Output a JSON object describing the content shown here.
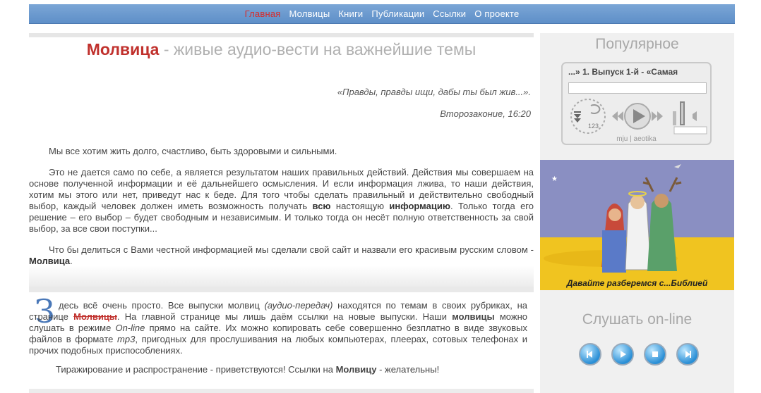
{
  "nav": {
    "items": [
      {
        "label": "Главная",
        "active": true
      },
      {
        "label": "Молвицы",
        "active": false
      },
      {
        "label": "Книги",
        "active": false
      },
      {
        "label": "Публикации",
        "active": false
      },
      {
        "label": "Ссылки",
        "active": false
      },
      {
        "label": "О проекте",
        "active": false
      }
    ]
  },
  "main": {
    "headline_brand": "Молвица",
    "headline_rest": " - живые аудио-вести на важнейшие темы",
    "quote": "«Правды, правды ищи, дабы ты был жив...».",
    "quote_source": "Второзаконие, 16:20",
    "paragraph1": "Мы все хотим жить долго, счастливо, быть здоровыми и сильными.",
    "paragraph2_a": "Это не дается само по себе, а является результатом наших правильных действий. Действия мы совершаем на основе полученной информации и её дальнейшего осмысления. И если информация лжива, то наши действия, хотим мы этого или нет, приведут нас к беде. Для того чтобы сделать правильный и действительно свободный выбор, каждый человек должен иметь возможность получать ",
    "paragraph2_b1": "всю",
    "paragraph2_mid": " настоящую ",
    "paragraph2_b2": "информацию",
    "paragraph2_c": ". Только тогда его решение – его выбор – будет свободным и независимым. И только тогда он несёт полную ответственность за свой выбор, за все свои поступки...",
    "paragraph3_a": "Что бы делиться с Вами честной информацией мы сделали свой сайт и назвали его красивым русским словом - ",
    "paragraph3_b": "Молвица",
    "paragraph3_c": ".",
    "dropcap": "З",
    "paragraph4_a": "десь всё очень просто. Все выпуски молвиц ",
    "paragraph4_i1": "(аудио-передач)",
    "paragraph4_b": " находятся по темам в своих рубриках, на странице ",
    "paragraph4_link": "Молвицы",
    "paragraph4_c": ". На главной странице мы лишь даём ссылки на новые выпуски. Наши ",
    "paragraph4_b2": "молвицы",
    "paragraph4_d": " можно слушать в режиме ",
    "paragraph4_i2": "On-line",
    "paragraph4_e": " прямо на сайте. Их можно копировать себе совершенно безплатно в виде звуковых файлов в формате ",
    "paragraph4_i3": "mp3",
    "paragraph4_f": ", пригодных для прослушивания на любых компьютерах, плеерах, сотовых телефонах и прочих подобных приспособлениях.",
    "paragraph5_a": "Тиражирование и распространение - приветствуются! Ссылки на ",
    "paragraph5_b": "Молвицу",
    "paragraph5_c": " - желательны!"
  },
  "sidebar": {
    "popular_title": "Популярное",
    "player_track": "...» 1. Выпуск 1-й - «Самая",
    "player_brand": "mju | aeotika",
    "player_counter": "123",
    "image_caption": "Давайте разберемся с...Библией",
    "listen_title": "Слушать on-line"
  },
  "colors": {
    "nav_bg": "#6a98cf",
    "accent_red": "#c0302c",
    "dropcap_blue": "#4a78b8"
  }
}
